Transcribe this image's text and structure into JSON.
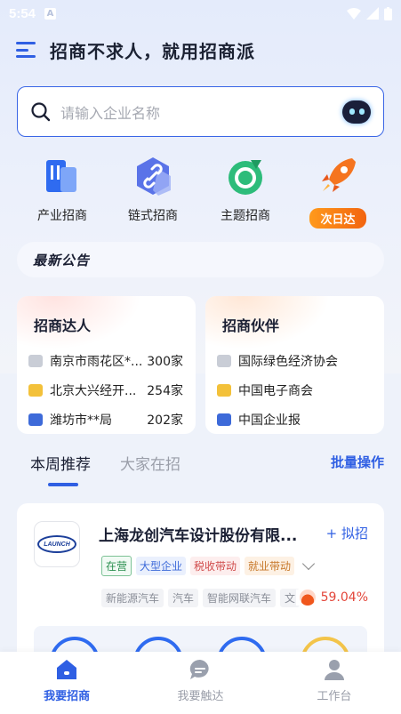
{
  "status_bar": {
    "time": "5:54",
    "notif_letter": "A"
  },
  "header": {
    "title": "招商不求人，就用招商派"
  },
  "search": {
    "placeholder": "请输入企业名称"
  },
  "quick_actions": [
    {
      "label": "产业招商",
      "icon": "industry-building-icon"
    },
    {
      "label": "链式招商",
      "icon": "chain-link-icon"
    },
    {
      "label": "主题招商",
      "icon": "theme-target-icon"
    },
    {
      "label": "次日达",
      "icon": "rocket-icon"
    }
  ],
  "notice": {
    "title": "最新公告"
  },
  "expert_card": {
    "title": "招商达人",
    "rows": [
      {
        "name": "南京市雨花区*...",
        "value": "300家",
        "rank_color": "#c9cdd6"
      },
      {
        "name": "北京大兴经开...",
        "value": "254家",
        "rank_color": "#f3c13a"
      },
      {
        "name": "潍坊市**局",
        "value": "202家",
        "rank_color": "#3d6ad9"
      }
    ]
  },
  "partner_card": {
    "title": "招商伙伴",
    "rows": [
      {
        "name": "国际绿色经济协会",
        "rank_color": "#c9cdd6"
      },
      {
        "name": "中国电子商会",
        "rank_color": "#f3c13a"
      },
      {
        "name": "中国企业报",
        "rank_color": "#3d6ad9"
      }
    ]
  },
  "tabs": {
    "this_week": "本周推荐",
    "everyone": "大家在招",
    "batch": "批量操作"
  },
  "company": {
    "logo_text": "LAUNCH",
    "name": "上海龙创汽车设计股份有限...",
    "follow_label": "+ 拟招",
    "status_tag": "在营",
    "tags": [
      "大型企业",
      "税收带动",
      "就业带动"
    ],
    "industries": [
      "新能源汽车",
      "汽车",
      "智能网联汽车",
      "文"
    ],
    "percent": "59.04%"
  },
  "bottom_nav": [
    {
      "label": "我要招商",
      "active": true
    },
    {
      "label": "我要触达",
      "active": false
    },
    {
      "label": "工作台",
      "active": false
    }
  ],
  "colors": {
    "accent": "#2f5fe3",
    "orange": "#f2640f"
  }
}
